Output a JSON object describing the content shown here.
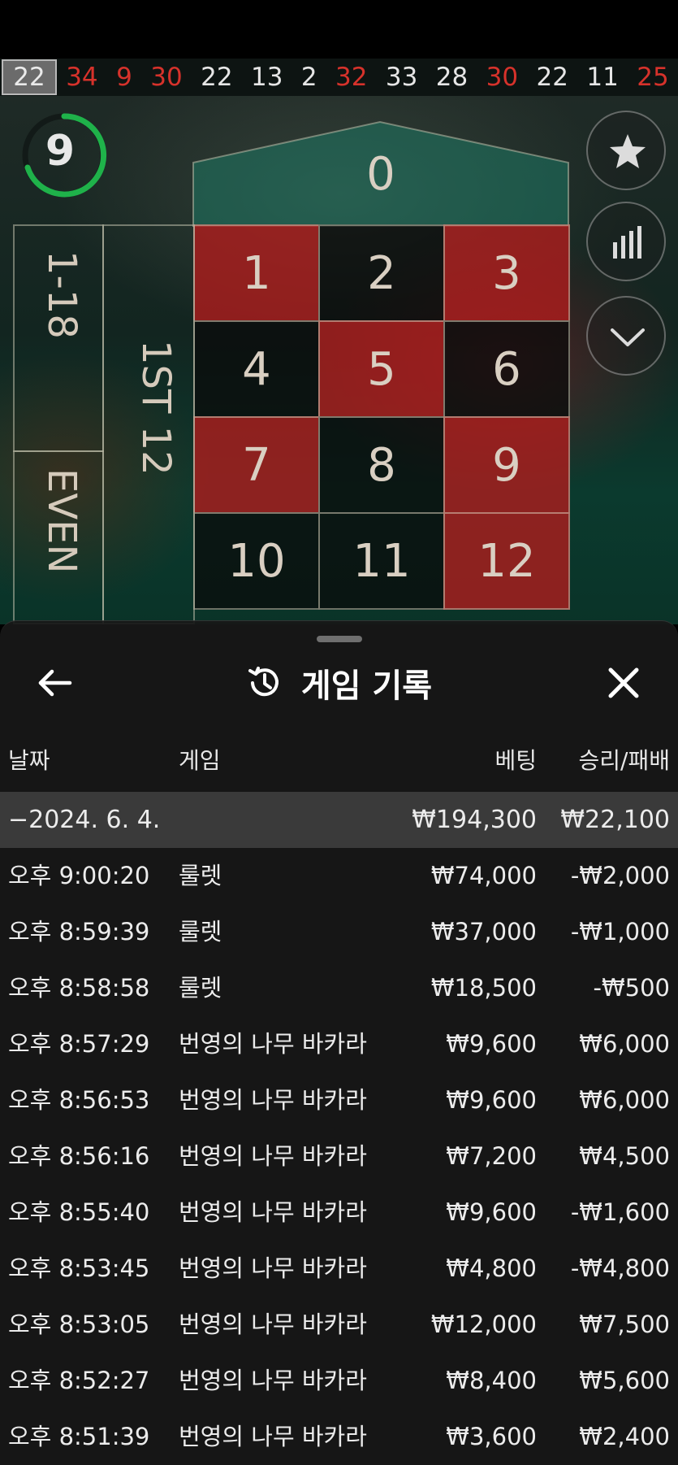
{
  "history_strip": {
    "numbers": [
      {
        "value": "22",
        "color": "gray"
      },
      {
        "value": "34",
        "color": "red"
      },
      {
        "value": "9",
        "color": "red"
      },
      {
        "value": "30",
        "color": "red"
      },
      {
        "value": "22",
        "color": "white"
      },
      {
        "value": "13",
        "color": "white"
      },
      {
        "value": "2",
        "color": "white"
      },
      {
        "value": "32",
        "color": "red"
      },
      {
        "value": "33",
        "color": "white"
      },
      {
        "value": "28",
        "color": "white"
      },
      {
        "value": "30",
        "color": "red"
      },
      {
        "value": "22",
        "color": "white"
      },
      {
        "value": "11",
        "color": "white"
      },
      {
        "value": "25",
        "color": "red"
      }
    ]
  },
  "timer": {
    "value": "9"
  },
  "board": {
    "zero": "0",
    "cells": [
      {
        "n": "1",
        "color": "red"
      },
      {
        "n": "2",
        "color": "black"
      },
      {
        "n": "3",
        "color": "red"
      },
      {
        "n": "4",
        "color": "black"
      },
      {
        "n": "5",
        "color": "red"
      },
      {
        "n": "6",
        "color": "black"
      },
      {
        "n": "7",
        "color": "red"
      },
      {
        "n": "8",
        "color": "black"
      },
      {
        "n": "9",
        "color": "red"
      },
      {
        "n": "10",
        "color": "black"
      },
      {
        "n": "11",
        "color": "black"
      },
      {
        "n": "12",
        "color": "red"
      }
    ],
    "outside_low": "1-18",
    "outside_even": "EVEN",
    "dozen_1": "1ST 12"
  },
  "side_buttons": {
    "favorite": "star-icon",
    "stats": "bar-chart-icon",
    "collapse": "chevron-down-icon"
  },
  "panel": {
    "title": "게임 기록",
    "columns": {
      "date": "날짜",
      "game": "게임",
      "bet": "베팅",
      "win_loss": "승리/패배"
    },
    "date_group": {
      "date": "−2024. 6. 4.",
      "bet": "₩194,300",
      "win_loss": "₩22,100"
    },
    "rows": [
      {
        "time": "오후 9:00:20",
        "game": "룰렛",
        "bet": "₩74,000",
        "win_loss": "-₩2,000"
      },
      {
        "time": "오후 8:59:39",
        "game": "룰렛",
        "bet": "₩37,000",
        "win_loss": "-₩1,000"
      },
      {
        "time": "오후 8:58:58",
        "game": "룰렛",
        "bet": "₩18,500",
        "win_loss": "-₩500"
      },
      {
        "time": "오후 8:57:29",
        "game": "번영의 나무 바카라",
        "bet": "₩9,600",
        "win_loss": "₩6,000"
      },
      {
        "time": "오후 8:56:53",
        "game": "번영의 나무 바카라",
        "bet": "₩9,600",
        "win_loss": "₩6,000"
      },
      {
        "time": "오후 8:56:16",
        "game": "번영의 나무 바카라",
        "bet": "₩7,200",
        "win_loss": "₩4,500"
      },
      {
        "time": "오후 8:55:40",
        "game": "번영의 나무 바카라",
        "bet": "₩9,600",
        "win_loss": "-₩1,600"
      },
      {
        "time": "오후 8:53:45",
        "game": "번영의 나무 바카라",
        "bet": "₩4,800",
        "win_loss": "-₩4,800"
      },
      {
        "time": "오후 8:53:05",
        "game": "번영의 나무 바카라",
        "bet": "₩12,000",
        "win_loss": "₩7,500"
      },
      {
        "time": "오후 8:52:27",
        "game": "번영의 나무 바카라",
        "bet": "₩8,400",
        "win_loss": "₩5,600"
      },
      {
        "time": "오후 8:51:39",
        "game": "번영의 나무 바카라",
        "bet": "₩3,600",
        "win_loss": "₩2,400"
      }
    ]
  },
  "colors": {
    "red": "#d6322b",
    "accent_green": "#1fb24a",
    "sheet_bg": "#181818",
    "date_row_bg": "#3a3a3a"
  }
}
